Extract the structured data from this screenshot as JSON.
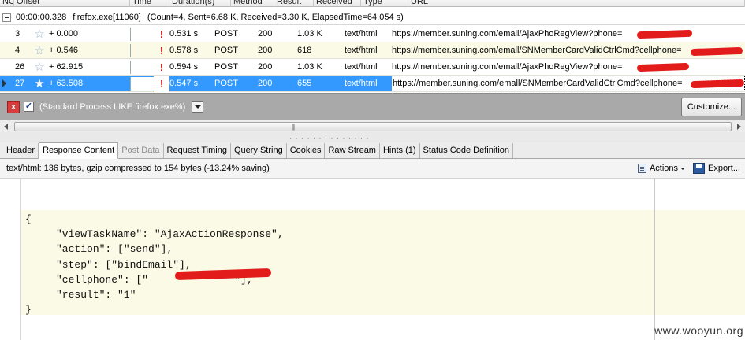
{
  "columns": {
    "no": "NO.",
    "offset": "Offset",
    "time": "Time",
    "duration": "Duration(s)",
    "method": "Method",
    "result": "Result",
    "received": "Received",
    "type": "Type",
    "url": "URL"
  },
  "group": {
    "time": "00:00:00.328",
    "process": "firefox.exe[11060]",
    "summary": "(Count=4, Sent=6.68 K, Received=3.30 K, ElapsedTime=64.054 s)"
  },
  "rows": [
    {
      "no": "3",
      "offset": "+ 0.000",
      "duration": "0.531 s",
      "method": "POST",
      "result": "200",
      "received": "1.03 K",
      "type": "text/html",
      "url": "https://member.suning.com/emall/AjaxPhoRegView?phone=",
      "starred": false
    },
    {
      "no": "4",
      "offset": "+ 0.546",
      "duration": "0.578 s",
      "method": "POST",
      "result": "200",
      "received": "618",
      "type": "text/html",
      "url": "https://member.suning.com/emall/SNMemberCardValidCtrlCmd?cellphone=",
      "starred": false
    },
    {
      "no": "26",
      "offset": "+ 62.915",
      "duration": "0.594 s",
      "method": "POST",
      "result": "200",
      "received": "1.03 K",
      "type": "text/html",
      "url": "https://member.suning.com/emall/AjaxPhoRegView?phone=",
      "starred": false
    },
    {
      "no": "27",
      "offset": "+ 63.508",
      "duration": "0.547 s",
      "method": "POST",
      "result": "200",
      "received": "655",
      "type": "text/html",
      "url": "https://member.suning.com/emall/SNMemberCardValidCtrlCmd?cellphone=",
      "starred": true,
      "selected": true
    }
  ],
  "filter": {
    "close_label": "x",
    "checkbox_label": "✓",
    "text": "(Standard Process LIKE firefox.exe%)",
    "customize_label": "Customize..."
  },
  "tabs": [
    "Header",
    "Response Content",
    "Post Data",
    "Request Timing",
    "Query String",
    "Cookies",
    "Raw Stream",
    "Hints (1)",
    "Status Code Definition"
  ],
  "info": {
    "text": "text/html: 136 bytes,  gzip compressed to 154 bytes (-13.24% saving)",
    "actions_label": "Actions",
    "export_label": "Export..."
  },
  "body_json": "{\n     \"viewTaskName\": \"AjaxActionResponse\",\n     \"action\": [\"send\"],\n     \"step\": [\"bindEmail\"],\n     \"cellphone\": [\"              \"],\n     \"result\": \"1\"\n}",
  "watermark": "www.wooyun.org",
  "colors": {
    "selected_row": "#3399ff",
    "alt_row": "#fafae6",
    "redaction": "#e21b1b",
    "filter_bar": "#a9a9a9"
  },
  "icons": {
    "star": "star-icon",
    "flag": "exclamation-icon",
    "close": "close-icon",
    "actions": "actions-icon",
    "export": "save-icon"
  }
}
